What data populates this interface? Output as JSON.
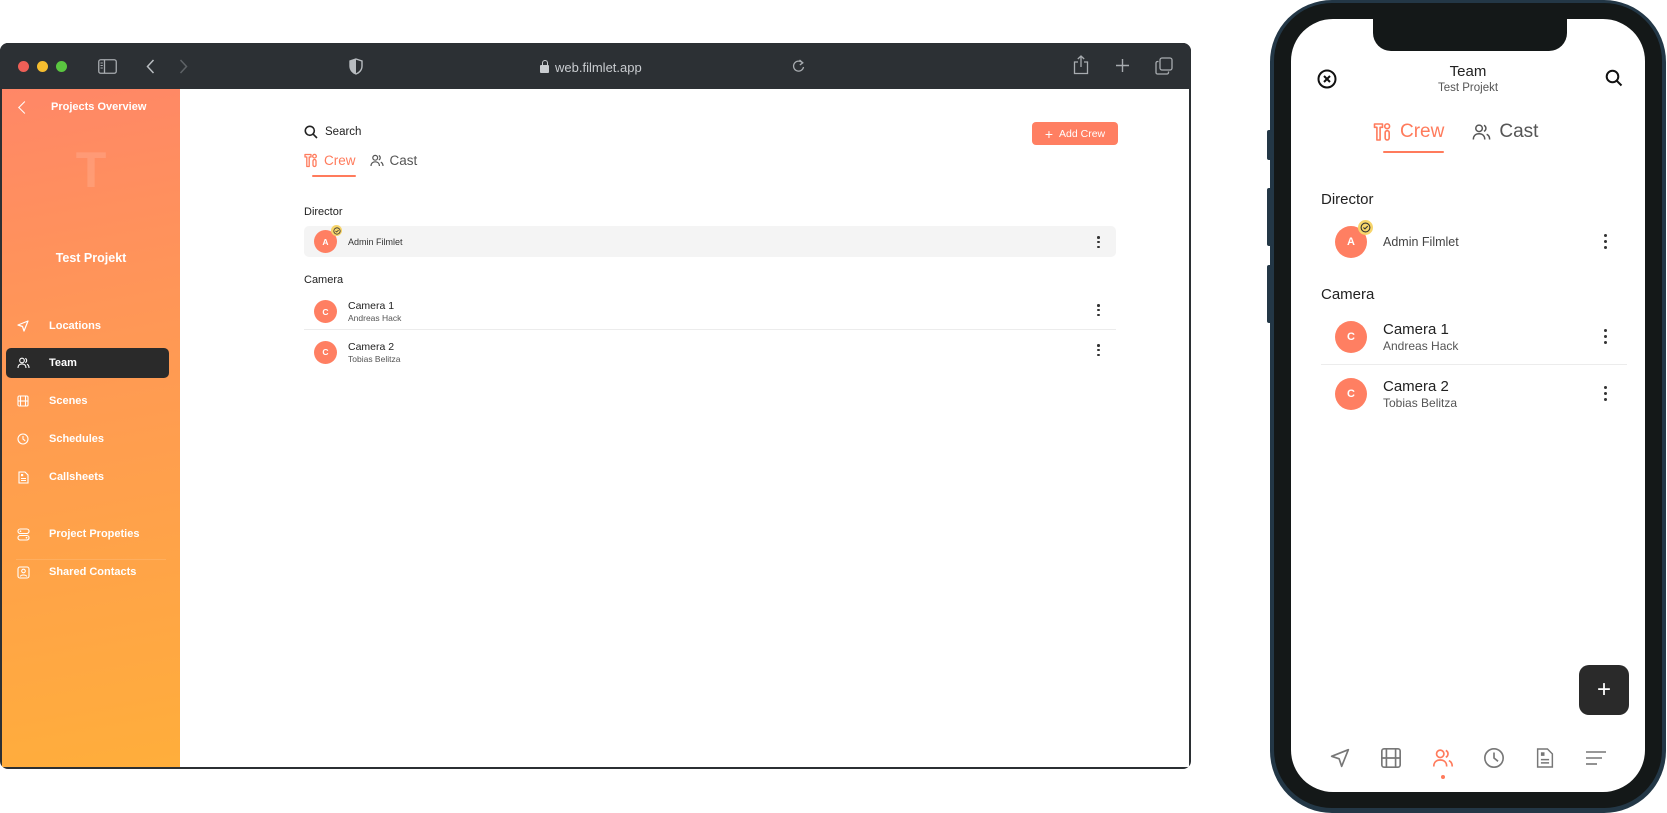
{
  "browser": {
    "url": "web.filmlet.app",
    "traffic_colors": {
      "close": "#ee5f57",
      "minimize": "#f5bd2f",
      "maximize": "#5ac640"
    }
  },
  "sidebar": {
    "back_label": "Projects Overview",
    "project_initial": "T",
    "project_name": "Test Projekt",
    "items": [
      {
        "id": "locations",
        "label": "Locations",
        "icon": "navigation-arrow-icon",
        "active": false
      },
      {
        "id": "team",
        "label": "Team",
        "icon": "users-icon",
        "active": true
      },
      {
        "id": "scenes",
        "label": "Scenes",
        "icon": "film-icon",
        "active": false
      },
      {
        "id": "schedules",
        "label": "Schedules",
        "icon": "clock-icon",
        "active": false
      },
      {
        "id": "callsheets",
        "label": "Callsheets",
        "icon": "document-icon",
        "active": false
      },
      {
        "id": "project-properties",
        "label": "Project Propeties",
        "icon": "toggles-icon",
        "active": false
      },
      {
        "id": "shared-contacts",
        "label": "Shared Contacts",
        "icon": "contact-card-icon",
        "active": false
      }
    ]
  },
  "main": {
    "search_label": "Search",
    "add_button_label": "Add Crew",
    "tabs": [
      {
        "label": "Crew",
        "active": true,
        "icon": "tools-icon"
      },
      {
        "label": "Cast",
        "active": false,
        "icon": "users-icon"
      }
    ],
    "sections": [
      {
        "title": "Director",
        "members": [
          {
            "initial": "A",
            "name": "Admin Filmlet",
            "subtitle": null,
            "verified": true
          }
        ]
      },
      {
        "title": "Camera",
        "members": [
          {
            "initial": "C",
            "name": "Camera 1",
            "subtitle": "Andreas Hack",
            "verified": false
          },
          {
            "initial": "C",
            "name": "Camera 2",
            "subtitle": "Tobias Belitza",
            "verified": false
          }
        ]
      }
    ]
  },
  "phone": {
    "title": "Team",
    "subtitle": "Test Projekt",
    "fab_label": "+",
    "bottom_nav": [
      {
        "icon": "navigation-arrow-icon",
        "active": false
      },
      {
        "icon": "film-icon",
        "active": false
      },
      {
        "icon": "users-icon",
        "active": true
      },
      {
        "icon": "clock-icon",
        "active": false
      },
      {
        "icon": "document-icon",
        "active": false
      },
      {
        "icon": "menu-lines-icon",
        "active": false
      }
    ]
  },
  "colors": {
    "accent": "#ff7b5c",
    "avatar": "#ff7f62",
    "badge": "#f7d56b",
    "sidebar_gradient_start": "#ff8767",
    "sidebar_gradient_end": "#ffae3b",
    "active_nav_bg": "#2a2a2a"
  }
}
